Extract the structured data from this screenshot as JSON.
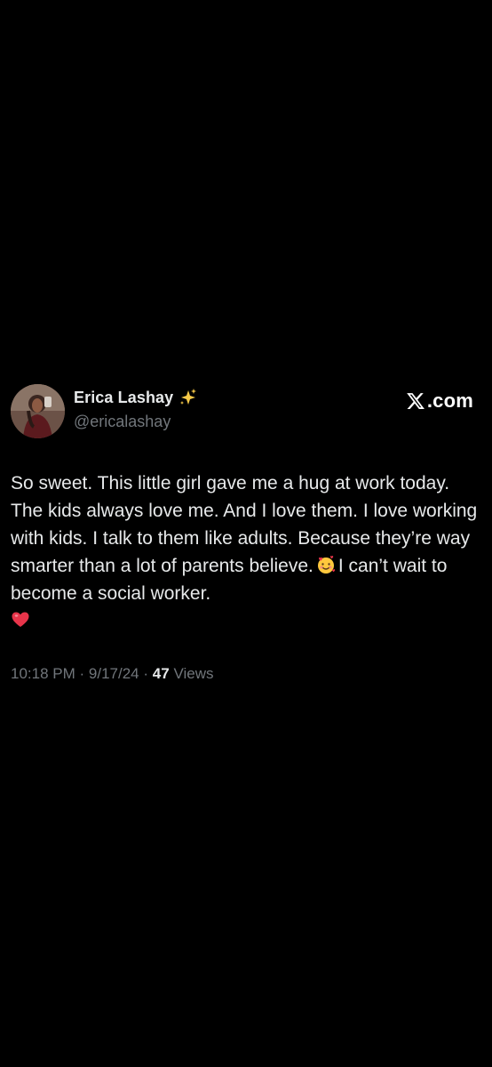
{
  "tweet": {
    "author": {
      "display_name": "Erica Lashay",
      "name_emoji": "sparkles-icon",
      "handle": "@ericalashay",
      "avatar": "avatar"
    },
    "brand": {
      "logo": "x-logo-icon",
      "text": ".com"
    },
    "body": {
      "text_part1": "So sweet. This little girl gave me a hug at work today. The kids always love me. And I love them. I love working with kids. I talk to them like adults. Because they’re way smarter than a lot of parents believe.",
      "emoji_1": "smiling-face-with-hearts-icon",
      "text_part2": "I can’t wait to become a social worker.",
      "emoji_2": "red-heart-icon"
    },
    "meta": {
      "time": "10:18 PM",
      "separator": "·",
      "date": "9/17/24",
      "views_count": "47",
      "views_label": "Views"
    },
    "colors": {
      "background": "#000000",
      "primary_text": "#e7e9ea",
      "secondary_text": "#71767b"
    }
  }
}
